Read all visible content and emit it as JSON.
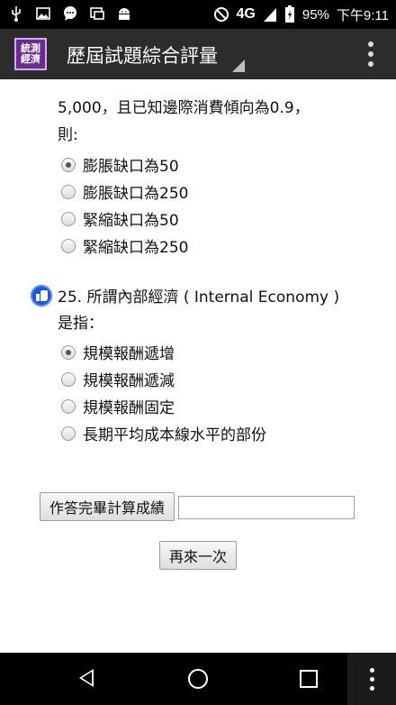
{
  "status_bar": {
    "icons": [
      "usb-icon",
      "image-icon",
      "chat-icon",
      "screen-icon",
      "android-icon"
    ],
    "network": "4G",
    "battery": "95%",
    "time": "下午9:11"
  },
  "app_bar": {
    "logo_text": "統測經濟",
    "title": "歷屆試題綜合評量"
  },
  "question_prev": {
    "text_line1": "5,000，且已知邊際消費傾向為0.9，",
    "text_line2": "則:",
    "options": [
      {
        "label": "膨脹缺口為50",
        "checked": true
      },
      {
        "label": "膨脹缺口為250",
        "checked": false
      },
      {
        "label": "緊縮缺口為50",
        "checked": false
      },
      {
        "label": "緊縮缺口為250",
        "checked": false
      }
    ]
  },
  "question_25": {
    "text_line1": "25. 所謂內部經濟 ( Internal Economy )",
    "text_line2": "是指：",
    "options": [
      {
        "label": "規模報酬遞增",
        "checked": true
      },
      {
        "label": "規模報酬遞減",
        "checked": false
      },
      {
        "label": "規模報酬固定",
        "checked": false
      },
      {
        "label": "長期平均成本線水平的部份",
        "checked": false
      }
    ]
  },
  "actions": {
    "score_button": "作答完畢計算成績",
    "score_value": "",
    "retry_button": "再來一次"
  }
}
